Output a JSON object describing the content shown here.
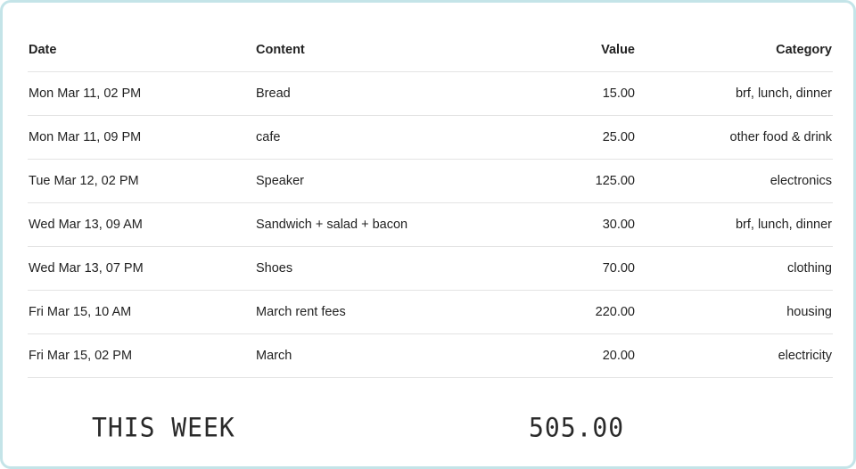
{
  "table": {
    "columns": [
      "Date",
      "Content",
      "Value",
      "Category"
    ],
    "rows": [
      {
        "date": "Mon Mar 11, 02 PM",
        "content": "Bread",
        "value": "15.00",
        "category": "brf, lunch, dinner"
      },
      {
        "date": "Mon Mar 11, 09 PM",
        "content": "cafe",
        "value": "25.00",
        "category": "other food & drink"
      },
      {
        "date": "Tue Mar 12, 02 PM",
        "content": "Speaker",
        "value": "125.00",
        "category": "electronics"
      },
      {
        "date": "Wed Mar 13, 09 AM",
        "content": "Sandwich + salad + bacon",
        "value": "30.00",
        "category": "brf, lunch, dinner"
      },
      {
        "date": "Wed Mar 13, 07 PM",
        "content": "Shoes",
        "value": "70.00",
        "category": "clothing"
      },
      {
        "date": "Fri Mar 15, 10 AM",
        "content": "March rent fees",
        "value": "220.00",
        "category": "housing"
      },
      {
        "date": "Fri Mar 15, 02 PM",
        "content": "March",
        "value": "20.00",
        "category": "electricity"
      }
    ]
  },
  "summary": {
    "label": "THIS WEEK",
    "total": "505.00"
  },
  "colors": {
    "border": "#c4e4e8",
    "divider": "#e3e3e3",
    "text": "#222222"
  }
}
